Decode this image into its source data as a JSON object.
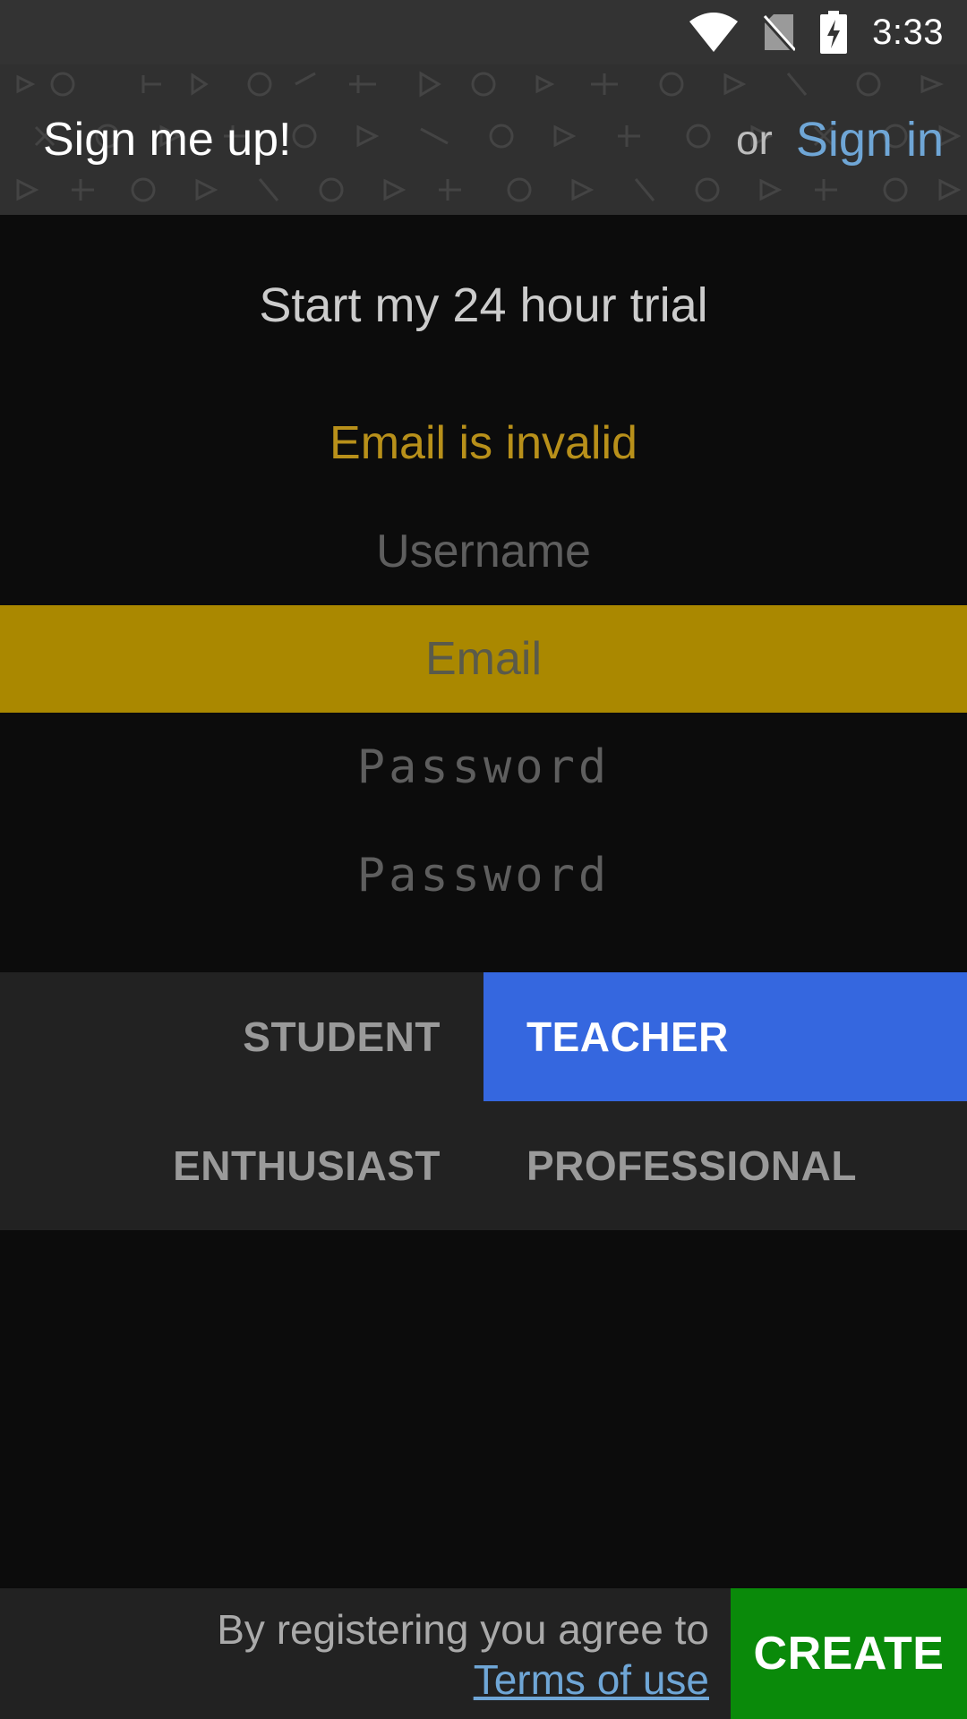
{
  "status_bar": {
    "time": "3:33",
    "icons": [
      "wifi-icon",
      "no-sim-icon",
      "battery-charging-icon"
    ]
  },
  "header": {
    "title": "Sign me up!",
    "or_text": "or",
    "signin_label": "Sign in"
  },
  "form": {
    "subtitle": "Start my 24 hour trial",
    "error": "Email is invalid",
    "username_placeholder": "Username",
    "email_placeholder": "Email",
    "password_placeholder": "Password",
    "password_confirm_placeholder": "Password"
  },
  "roles": {
    "options": [
      "STUDENT",
      "TEACHER",
      "ENTHUSIAST",
      "PROFESSIONAL"
    ],
    "selected": "TEACHER"
  },
  "footer": {
    "agree_text": "By registering you agree to",
    "terms_label": "Terms of use",
    "create_label": "CREATE"
  },
  "colors": {
    "accent_blue": "#3567df",
    "link_blue": "#6fa6d6",
    "error_gold": "#b8901a",
    "field_highlight": "#aa8800",
    "create_green": "#0a8a0a"
  }
}
